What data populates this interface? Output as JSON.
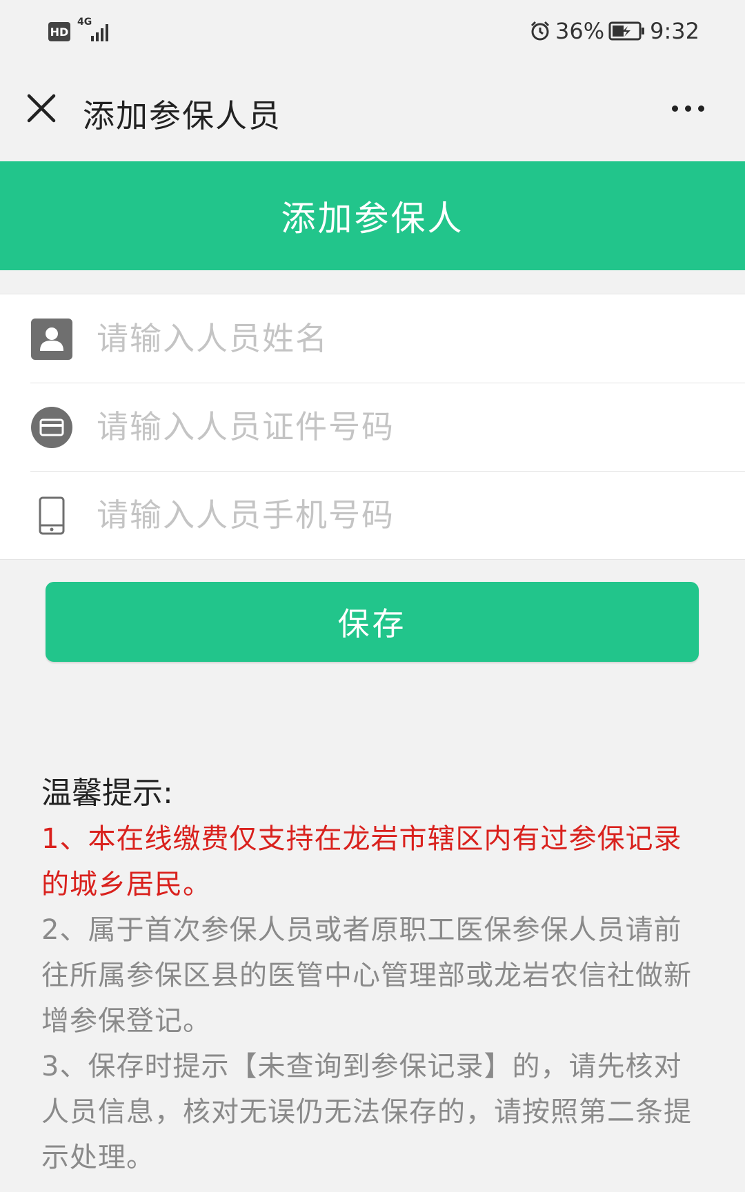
{
  "status_bar": {
    "hd": "HD",
    "network": "4G",
    "battery_percent": "36%",
    "time": "9:32",
    "icons": [
      "signal-icon",
      "alarm-icon",
      "battery-charging-icon"
    ]
  },
  "title_bar": {
    "title": "添加参保人员",
    "close_icon": "close-icon",
    "more_icon": "more-icon"
  },
  "banner": {
    "title": "添加参保人",
    "color": "#22c58b"
  },
  "form": {
    "name_placeholder": "请输入人员姓名",
    "id_placeholder": "请输入人员证件号码",
    "phone_placeholder": "请输入人员手机号码",
    "icons": [
      "person-icon",
      "id-card-icon",
      "phone-icon"
    ]
  },
  "save_label": "保存",
  "tips": {
    "title": "温馨提示:",
    "items": [
      "1、本在线缴费仅支持在龙岩市辖区内有过参保记录的城乡居民。",
      "2、属于首次参保人员或者原职工医保参保人员请前往所属参保区县的医管中心管理部或龙岩农信社做新增参保登记。",
      "3、保存时提示【未查询到参保记录】的，请先核对人员信息，核对无误仍无法保存的，请按照第二条提示处理。"
    ],
    "colors": {
      "highlight": "#d9211d",
      "normal": "#8a8a8a"
    }
  }
}
